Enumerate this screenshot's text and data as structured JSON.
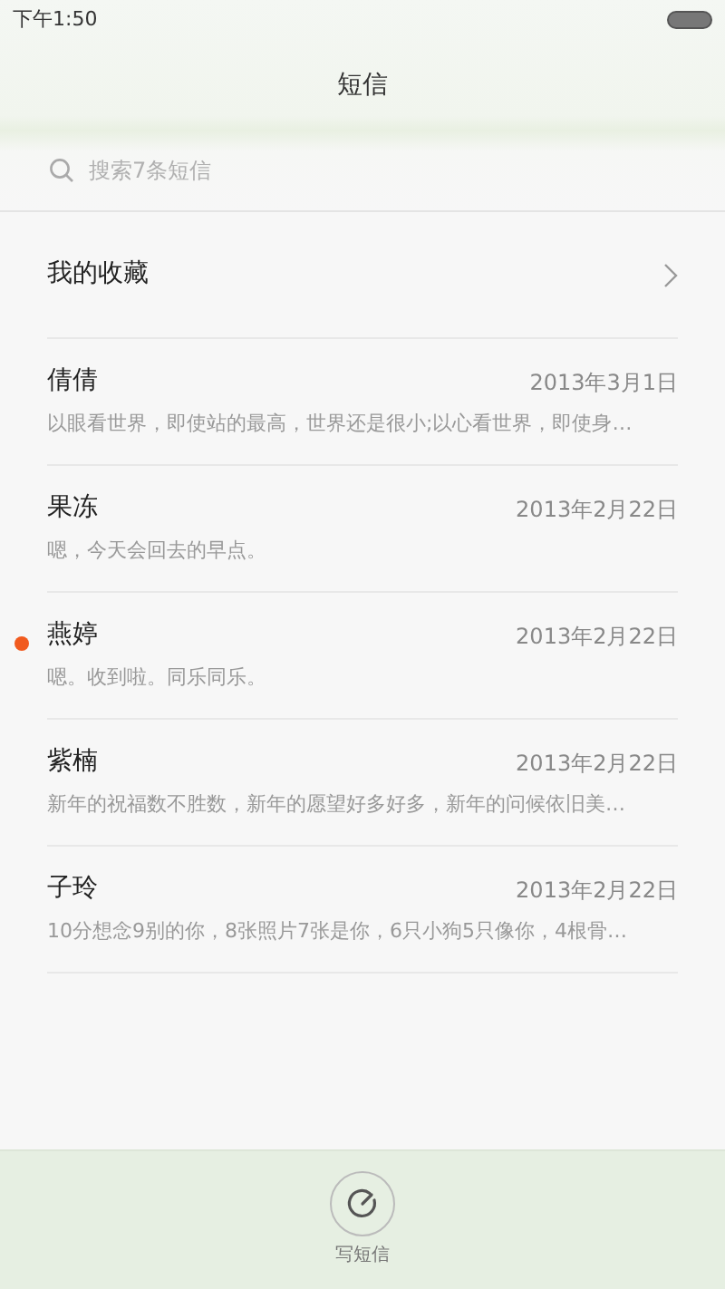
{
  "status_bar": {
    "time": "下午1:50"
  },
  "title": "短信",
  "search": {
    "placeholder": "搜索7条短信"
  },
  "favorites": {
    "label": "我的收藏"
  },
  "conversations": [
    {
      "name": "倩倩",
      "date": "2013年3月1日",
      "preview": "以眼看世界，即使站的最高，世界还是很小;以心看世界，即使身…",
      "unread": false
    },
    {
      "name": "果冻",
      "date": "2013年2月22日",
      "preview": "嗯，今天会回去的早点。",
      "unread": false
    },
    {
      "name": "燕婷",
      "date": "2013年2月22日",
      "preview": "嗯。收到啦。同乐同乐。",
      "unread": true
    },
    {
      "name": "紫楠",
      "date": "2013年2月22日",
      "preview": "新年的祝福数不胜数，新年的愿望好多好多，新年的问候依旧美…",
      "unread": false
    },
    {
      "name": "子玲",
      "date": "2013年2月22日",
      "preview": "10分想念9别的你，8张照片7张是你，6只小狗5只像你，4根骨…",
      "unread": false
    }
  ],
  "compose": {
    "label": "写短信"
  }
}
